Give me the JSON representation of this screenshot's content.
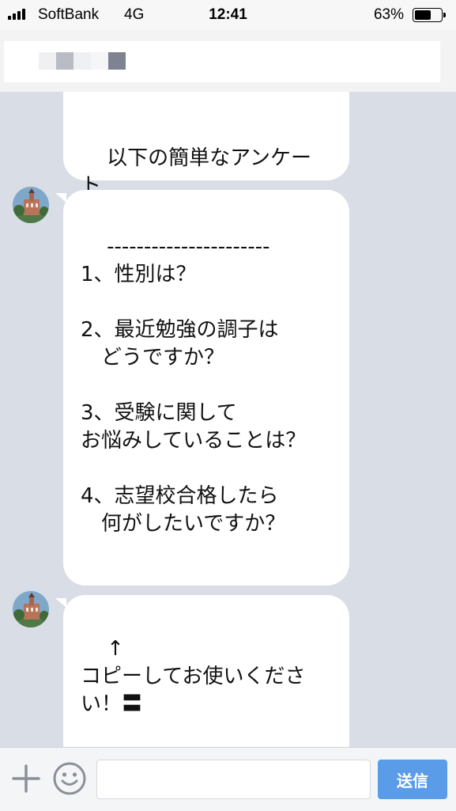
{
  "status_bar": {
    "carrier": "SoftBank",
    "network": "4G",
    "time": "12:41",
    "battery_percent_label": "63%",
    "battery_level": 0.63
  },
  "messages": [
    {
      "text": "以下の簡単なアンケート\nにご協力お願いします！"
    },
    {
      "text": "----------------------\n1、性別は？\n\n2、最近勉強の調子は\n　どうですか？\n\n3、受験に関して\nお悩みしていることは？\n\n4、志望校合格したら\n　何がしたいですか？\n\n\n---------------------"
    },
    {
      "text": "↑\nコピーしてお使いくださ\nい！〓\n\nアンケートに答えていた\nだいた方からまとめ無料"
    }
  ],
  "input": {
    "placeholder": "",
    "value": "",
    "send_label": "送信"
  },
  "icons": {
    "plus": "plus-icon",
    "emoji": "smiley-icon",
    "avatar": "building-avatar-icon",
    "signal": "signal-bars-icon",
    "battery": "battery-icon"
  },
  "colors": {
    "chat_background": "#d8dde6",
    "bubble": "#ffffff",
    "send_button": "#5b9ce8",
    "icon_gray": "#8a9099"
  }
}
